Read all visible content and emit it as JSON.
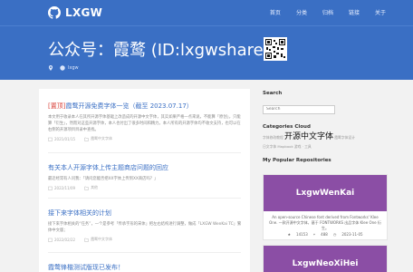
{
  "nav": {
    "logo_text": "LXGW",
    "menu": [
      "首页",
      "分类",
      "归档",
      "链接",
      "关于"
    ]
  },
  "hero": {
    "title": "公众号：霞鹜 (ID:lxgwshare)",
    "meta": "lxgw"
  },
  "posts": [
    {
      "tag": "[置顶]",
      "title": "霞鹜开源免费字体一览（截至 2023.07.17）",
      "excerpt": "本文用于收录本人在其所开源字体基础上改造成的开源中文字体，其实如果严格一点来说，不能算「原创」，只能算「衍生」，然而对这些开源字体，本人也付出了很多时间和精力。本人所有的开源字体均不收文支持，也可以在右侧的开源项目目录中查找。",
      "date": "2021/01/15",
      "category": "霞鹜中文字体"
    },
    {
      "tag": "",
      "title": "有关本人开源字体上传主题商店问题的回应",
      "excerpt": "最近经常有人问我：「请问您能否把XX字体上传到XX商店吗？」",
      "date": "2022/11/09",
      "category": "其他"
    },
    {
      "tag": "",
      "title": "接下来字体相关的计划",
      "excerpt": "接下来字体相关的“任务”，一个是参考「传承字形的宋体」把左右结构进行调整，做成「LXGW WenKai TC」繁体中文版；",
      "date": "2022/02/22",
      "category": "霞鹜中文字体"
    },
    {
      "tag": "",
      "title": "霞鹜锋楷测试版现已发布！",
      "excerpt": "",
      "date": "",
      "category": ""
    }
  ],
  "sidebar": {
    "search_heading": "Search",
    "search_placeholder": "Search",
    "categories_heading": "Categories Cloud",
    "cloud_small_1": "字体修改教程",
    "cloud_big": "开源中文字体",
    "cloud_small_2": "霞鹜字体设计",
    "cloud_small_3": "日文字体 Mapbook 游戏 · 工具",
    "repos_heading": "My Popular Repositories",
    "repos": [
      {
        "name": "LxgwWenKai",
        "desc": "An open-source Chinese font derived from Fontworks' Klee One. 一款开源中文字体，基于 FONTWORKS 出品字体 Klee One 衍生。",
        "stars": "14153",
        "forks": "488",
        "updated": "2023-11-05",
        "color": "#8b4ea5"
      },
      {
        "name": "LxgwNeoXiHei",
        "desc": "",
        "stars": "",
        "forks": "",
        "updated": "",
        "color": "#8b4ea5"
      }
    ]
  },
  "colors": {
    "brand": "#3a6fc4",
    "sticky_tag": "#d9443c",
    "repo_banner": "#8b4ea5"
  }
}
